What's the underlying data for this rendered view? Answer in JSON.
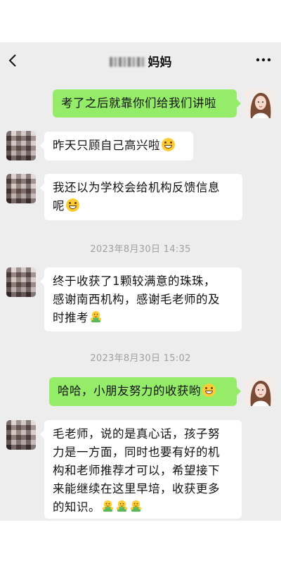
{
  "header": {
    "title": "妈妈",
    "back_icon": "chevron-left-icon",
    "more_icon": "more-dots-icon"
  },
  "messages": [
    {
      "sender": "me",
      "text": "考了之后就靠你们给我们讲啦",
      "emoji": []
    },
    {
      "sender": "other",
      "text": "昨天只顾自己高兴啦",
      "emoji": [
        "grin"
      ]
    },
    {
      "sender": "other",
      "lines": [
        "我还以为学校会给机构反馈信息",
        "呢"
      ],
      "emoji": [
        "grin"
      ]
    },
    {
      "sender": "other",
      "lines": [
        "终于收获了1颗较满意的珠珠，",
        "感谢南西机构，感谢毛老师的及",
        "时推考"
      ],
      "emoji": [
        "hug"
      ]
    },
    {
      "sender": "me",
      "text": "哈哈，小朋友努力的收获哟",
      "emoji": [
        "grin"
      ]
    },
    {
      "sender": "other",
      "lines": [
        "毛老师，说的是真心话，孩子努",
        "力是一方面，同时也要有好的机",
        "构和老师推荐才可以，希望接下",
        "来能继续在这里早培，收获更多",
        "的知识。"
      ],
      "emoji": [
        "hug",
        "hug",
        "hug"
      ]
    }
  ],
  "timestamps": [
    "2023年8月30日 14:35",
    "2023年8月30日 15:02"
  ],
  "colors": {
    "chat_bg": "#ededed",
    "bubble_out": "#95ec69",
    "bubble_in": "#ffffff",
    "timestamp_text": "#a0a0a0"
  }
}
